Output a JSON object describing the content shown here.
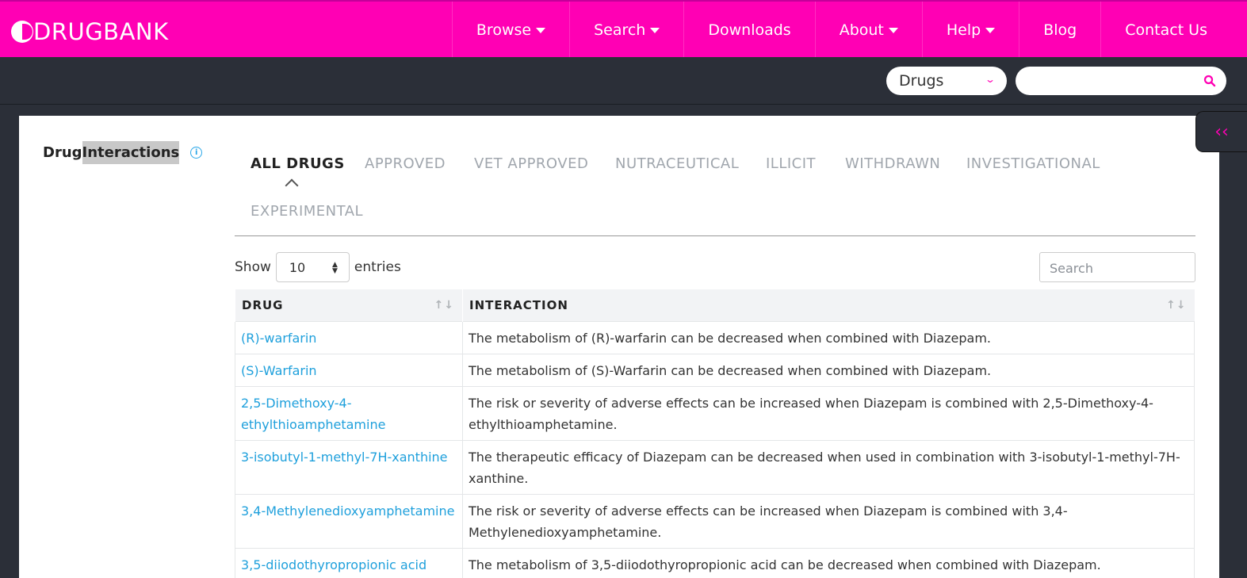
{
  "brand": {
    "name": "DRUGBANK"
  },
  "nav": {
    "items": [
      {
        "label": "Browse",
        "dropdown": true
      },
      {
        "label": "Search",
        "dropdown": true
      },
      {
        "label": "Downloads",
        "dropdown": false
      },
      {
        "label": "About",
        "dropdown": true
      },
      {
        "label": "Help",
        "dropdown": true
      },
      {
        "label": "Blog",
        "dropdown": false
      },
      {
        "label": "Contact Us",
        "dropdown": false
      }
    ]
  },
  "search": {
    "type_selected": "Drugs",
    "placeholder": ""
  },
  "section": {
    "title_part1": "Drug ",
    "title_part2": "Interactions"
  },
  "tabs": [
    "ALL DRUGS",
    "APPROVED",
    "VET APPROVED",
    "NUTRACEUTICAL",
    "ILLICIT",
    "WITHDRAWN",
    "INVESTIGATIONAL",
    "EXPERIMENTAL"
  ],
  "active_tab": "ALL DRUGS",
  "table_controls": {
    "show_label": "Show",
    "entries_value": "10",
    "entries_label": "entries",
    "filter_placeholder": "Search"
  },
  "table": {
    "columns": [
      "DRUG",
      "INTERACTION"
    ],
    "rows": [
      {
        "drug": "(R)-warfarin",
        "interaction": "The metabolism of (R)-warfarin can be decreased when combined with Diazepam."
      },
      {
        "drug": "(S)-Warfarin",
        "interaction": "The metabolism of (S)-Warfarin can be decreased when combined with Diazepam."
      },
      {
        "drug": "2,5-Dimethoxy-4-ethylthioamphetamine",
        "interaction": "The risk or severity of adverse effects can be increased when Diazepam is combined with 2,5-Dimethoxy-4-ethylthioamphetamine."
      },
      {
        "drug": "3-isobutyl-1-methyl-7H-xanthine",
        "interaction": "The therapeutic efficacy of Diazepam can be decreased when used in combination with 3-isobutyl-1-methyl-7H-xanthine."
      },
      {
        "drug": "3,4-Methylenedioxyamphetamine",
        "interaction": "The risk or severity of adverse effects can be increased when Diazepam is combined with 3,4-Methylenedioxyamphetamine."
      },
      {
        "drug": "3,5-diiodothyropropionic acid",
        "interaction": "The metabolism of 3,5-diiodothyropropionic acid can be decreased when combined with Diazepam."
      }
    ]
  },
  "colors": {
    "brand": "#ff00b4",
    "dark": "#2b2f38",
    "link": "#1fa0dc"
  },
  "icons": {
    "search": "search-icon",
    "collapse": "double-chevron-left-icon",
    "info": "info-icon"
  }
}
